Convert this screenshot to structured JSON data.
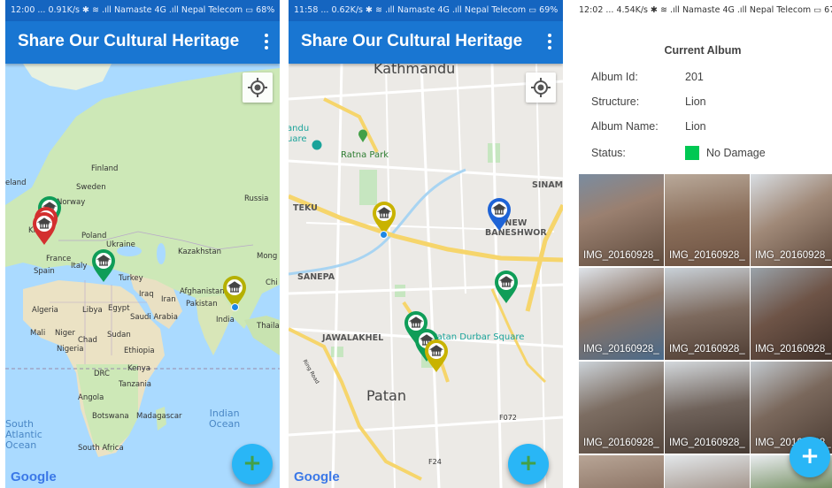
{
  "colors": {
    "app_bar": "#1976d2",
    "status_bar": "#1565c0",
    "fab": "#29b6f6",
    "status_no_damage": "#00c853",
    "pin_green": "#0f9d58",
    "pin_red": "#d32f2f",
    "pin_yellow": "#c9b300",
    "pin_blue": "#1e63d6"
  },
  "app": {
    "title": "Share Our Cultural Heritage",
    "menu_icon": "more-vert-icon"
  },
  "screen1": {
    "status_bar": "12:00 ... 0.91K/s ✱ ≋ .ıll Namaste 4G .ıll Nepal Telecom ▭ 68%",
    "location_button_icon": "my-location-icon",
    "fab_icon": "plus-icon",
    "attribution": "Google",
    "labels": {
      "finland": "Finland",
      "sweden": "Sweden",
      "norway": "Norway",
      "iceland": "eland",
      "russia": "Russia",
      "united_kingdom": "Kin",
      "poland": "Poland",
      "ukraine": "Ukraine",
      "france": "France",
      "italy": "Italy",
      "spain": "Spain",
      "kazakhstan": "Kazakhstan",
      "mongolia": "Mong",
      "china": "Chi",
      "turkey": "Turkey",
      "iraq": "Iraq",
      "iran": "Iran",
      "afghanistan": "Afghanistan",
      "pakistan": "Pakistan",
      "india": "India",
      "thailand": "Thailan",
      "algeria": "Algeria",
      "libya": "Libya",
      "egypt": "Egypt",
      "saudi_arabia": "Saudi Arabia",
      "mali": "Mali",
      "niger": "Niger",
      "chad": "Chad",
      "sudan": "Sudan",
      "nigeria": "Nigeria",
      "ethiopia": "Ethiopia",
      "kenya": "Kenya",
      "drc": "DRC",
      "tanzania": "Tanzania",
      "angola": "Angola",
      "botswana": "Botswana",
      "madagascar": "Madagascar",
      "south_africa": "South Africa",
      "south_atlantic_ocean": "South\nAtlantic\nOcean",
      "indian_ocean": "Indian\nOcean"
    },
    "pins": [
      {
        "color": "green",
        "icon": "heritage-site-icon"
      },
      {
        "color": "red",
        "icon": "heritage-site-icon"
      },
      {
        "color": "red",
        "icon": "heritage-site-icon"
      },
      {
        "color": "green",
        "icon": "heritage-site-icon"
      },
      {
        "color": "yellow",
        "icon": "heritage-site-icon"
      }
    ]
  },
  "screen2": {
    "status_bar": "11:58 ... 0.62K/s ✱ ≋ .ıll Namaste 4G .ıll Nepal Telecom ▭ 69%",
    "location_button_icon": "my-location-icon",
    "fab_icon": "plus-icon",
    "attribution": "Google",
    "labels": {
      "kathmandu": "Kathmandu",
      "kathmandu_square": "andu\nuare",
      "ratna_park": "Ratna Park",
      "sinam": "SINAM",
      "teku": "TEKU",
      "new_baneshwor": "NEW\nBANESHWOR",
      "sanepa": "SANEPA",
      "jawalakhel": "JAWALAKHEL",
      "patan_durbar_square": "Patan Durbar Square",
      "patan": "Patan",
      "ring_road": "Ring Road",
      "f072": "F072",
      "f24": "F24"
    },
    "pins": [
      {
        "color": "yellow",
        "icon": "heritage-site-icon"
      },
      {
        "color": "blue",
        "icon": "heritage-site-icon"
      },
      {
        "color": "green",
        "icon": "heritage-site-icon"
      },
      {
        "color": "green",
        "icon": "heritage-site-icon"
      },
      {
        "color": "green",
        "icon": "heritage-site-icon"
      },
      {
        "color": "yellow",
        "icon": "heritage-site-icon"
      }
    ]
  },
  "screen3": {
    "status_bar": "12:02 ... 4.54K/s ✱ ≋ .ıll Namaste 4G .ıll Nepal Telecom ▭ 67",
    "title": "Current Album",
    "album_id_label": "Album Id:",
    "album_id": "201",
    "structure_label": "Structure:",
    "structure": "Lion",
    "album_name_label": "Album Name:",
    "album_name": "Lion",
    "status_label": "Status:",
    "status": "No Damage",
    "photos": [
      "IMG_20160928_",
      "IMG_20160928_",
      "IMG_20160928_",
      "IMG_20160928_",
      "IMG_20160928_",
      "IMG_20160928_",
      "IMG_20160928_",
      "IMG_20160928_",
      "IMG_20160928_"
    ],
    "fab_icon": "plus-icon"
  }
}
